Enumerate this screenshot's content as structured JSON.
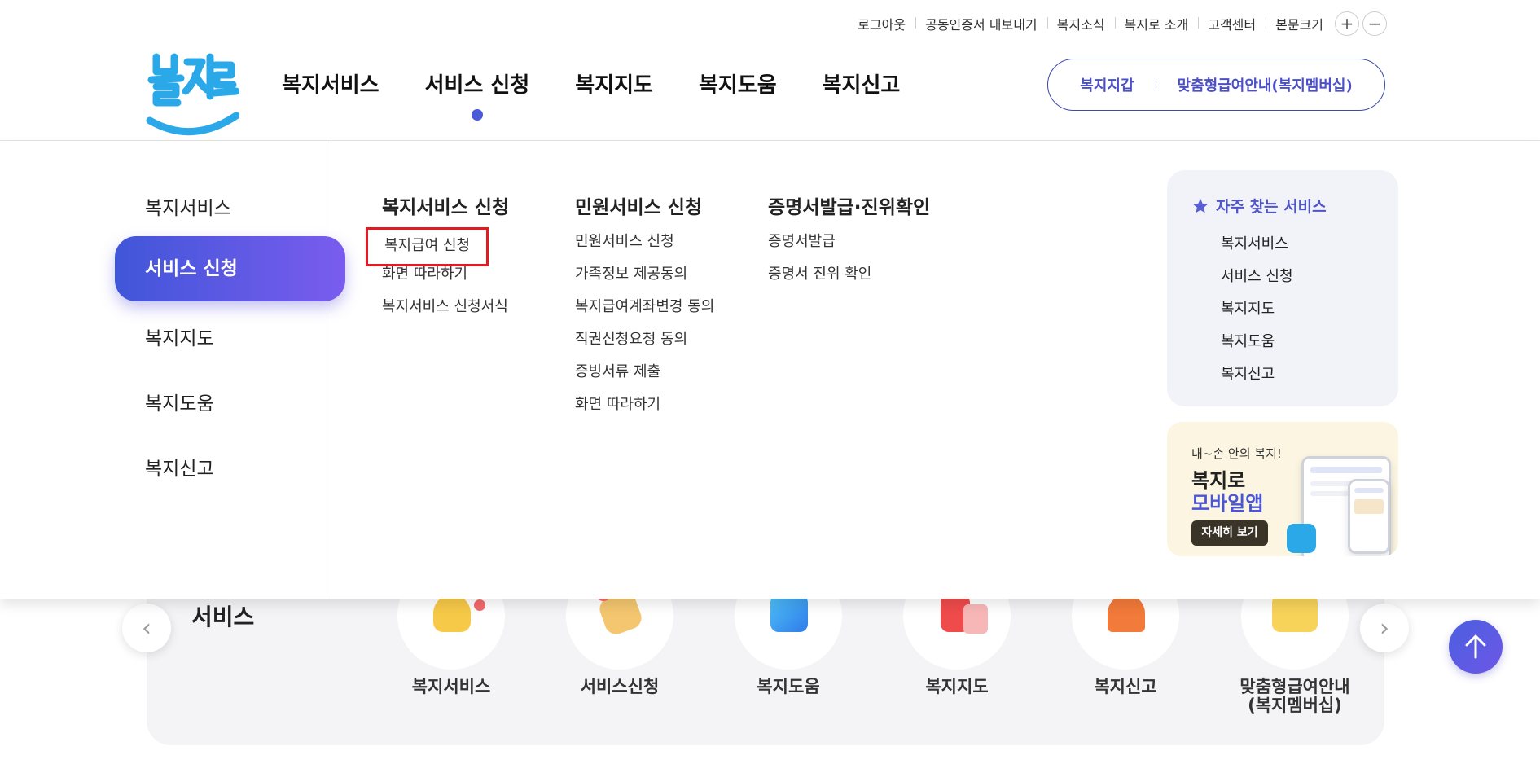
{
  "utility": {
    "logout": "로그아웃",
    "cert_export": "공동인증서 내보내기",
    "news": "복지소식",
    "about": "복지로 소개",
    "support": "고객센터",
    "text_size": "본문크기",
    "zoom_in": "+",
    "zoom_out": "−"
  },
  "logo": {
    "alt": "복지로"
  },
  "gnb": [
    {
      "label": "복지서비스"
    },
    {
      "label": "서비스 신청"
    },
    {
      "label": "복지지도"
    },
    {
      "label": "복지도움"
    },
    {
      "label": "복지신고"
    }
  ],
  "pill": {
    "wallet": "복지지갑",
    "membership": "맞춤형급여안내(복지멤버십)"
  },
  "mega": {
    "side": [
      {
        "label": "복지서비스"
      },
      {
        "label": "서비스 신청"
      },
      {
        "label": "복지지도"
      },
      {
        "label": "복지도움"
      },
      {
        "label": "복지신고"
      }
    ],
    "columns": [
      {
        "title": "복지서비스 신청",
        "links": [
          "복지급여 신청",
          "화면 따라하기",
          "복지서비스 신청서식"
        ]
      },
      {
        "title": "민원서비스 신청",
        "links": [
          "민원서비스 신청",
          "가족정보 제공동의",
          "복지급여계좌변경 동의",
          "직권신청요청 동의",
          "증빙서류 제출",
          "화면 따라하기"
        ]
      },
      {
        "title": "증명서발급·진위확인",
        "links": [
          "증명서발급",
          "증명서 진위 확인"
        ]
      }
    ],
    "favorites": {
      "title": "자주 찾는 서비스",
      "items": [
        "복지서비스",
        "서비스 신청",
        "복지지도",
        "복지도움",
        "복지신고"
      ]
    },
    "promo": {
      "line1": "내~손 안의 복지!",
      "line2": "복지로",
      "line3": "모바일앱",
      "button": "자세히 보기"
    }
  },
  "background": {
    "section_title": "서비스",
    "services": [
      {
        "label": "복지서비스"
      },
      {
        "label": "서비스신청"
      },
      {
        "label": "복지도움"
      },
      {
        "label": "복지지도"
      },
      {
        "label": "복지신고"
      },
      {
        "label": "맞춤형급여안내\n(복지멤버십)"
      }
    ]
  },
  "colors": {
    "accent": "#4a5ad8",
    "highlight_box": "#e11b22",
    "logo_blue": "#2aa8e8"
  }
}
